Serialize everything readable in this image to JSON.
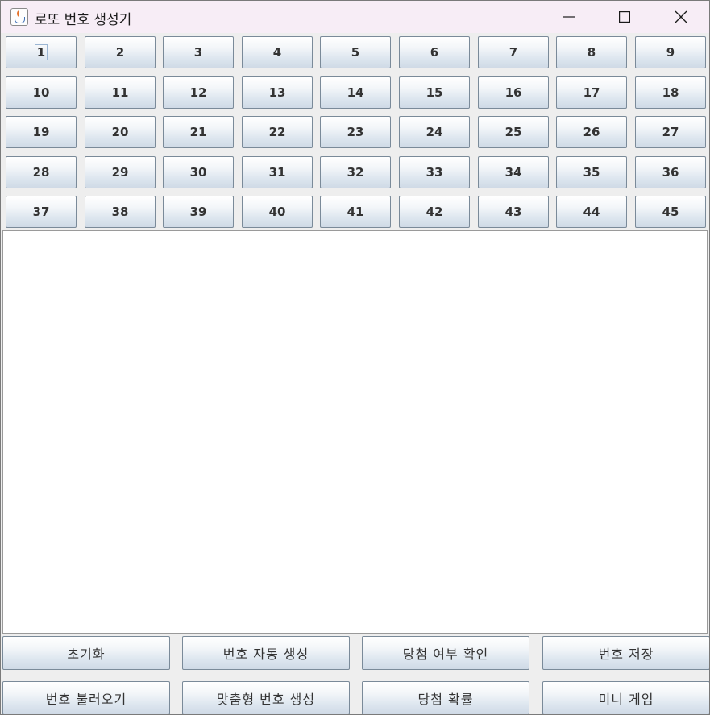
{
  "window": {
    "title": "로또 번호 생성기",
    "icon": "java-cup-icon",
    "controls": [
      "minimize-icon",
      "maximize-icon",
      "close-icon"
    ]
  },
  "number_buttons": [
    "1",
    "2",
    "3",
    "4",
    "5",
    "6",
    "7",
    "8",
    "9",
    "10",
    "11",
    "12",
    "13",
    "14",
    "15",
    "16",
    "17",
    "18",
    "19",
    "20",
    "21",
    "22",
    "23",
    "24",
    "25",
    "26",
    "27",
    "28",
    "29",
    "30",
    "31",
    "32",
    "33",
    "34",
    "35",
    "36",
    "37",
    "38",
    "39",
    "40",
    "41",
    "42",
    "43",
    "44",
    "45"
  ],
  "output_text": "",
  "actions": {
    "reset": "초기화",
    "auto_generate": "번호 자동 생성",
    "check_win": "당첨 여부 확인",
    "save": "번호 저장",
    "load": "번호 불러오기",
    "custom_generate": "맞춤형 번호 생성",
    "probability": "당첨 확률",
    "mini_game": "미니 게임"
  }
}
